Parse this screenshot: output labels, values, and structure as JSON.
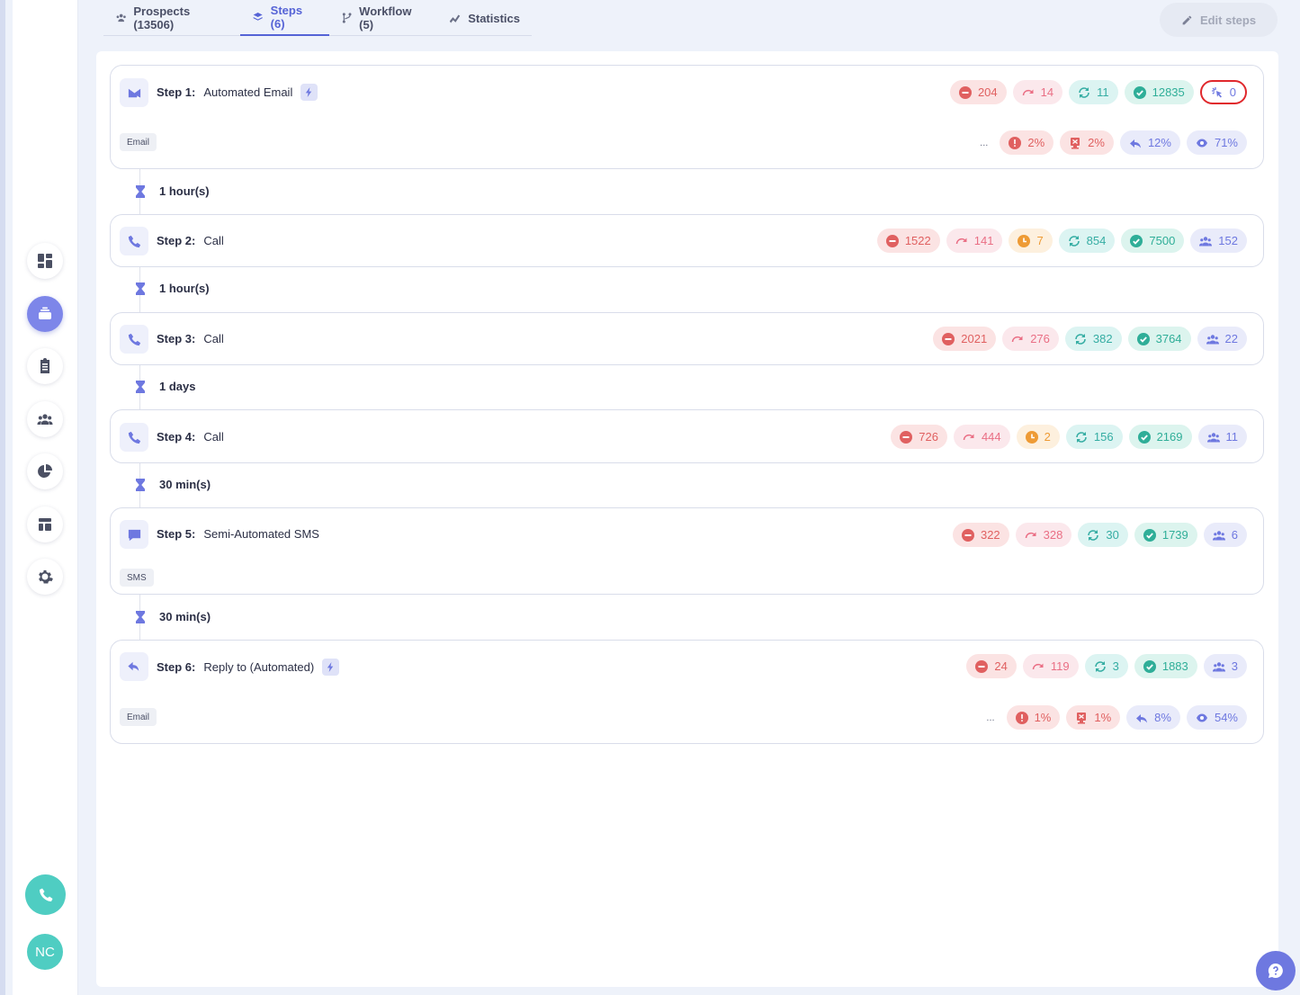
{
  "tabs": [
    {
      "label": "Prospects (13506)",
      "icon": "users-icon",
      "active": false
    },
    {
      "label": "Steps (6)",
      "icon": "layers-icon",
      "active": true
    },
    {
      "label": "Workflow (5)",
      "icon": "flow-icon",
      "active": false
    },
    {
      "label": "Statistics",
      "icon": "chart-line-icon",
      "active": false
    }
  ],
  "edit_button": {
    "label": "Edit steps"
  },
  "sidebar": {
    "items": [
      "dashboard-icon",
      "sequences-icon",
      "tasks-icon",
      "contacts-icon",
      "reports-icon",
      "templates-icon",
      "settings-icon"
    ],
    "active_index": 1,
    "avatar": "NC"
  },
  "steps": [
    {
      "label": "Step 1:",
      "name": "Automated Email",
      "type": "email",
      "automated": true,
      "tag": "Email",
      "stats": [
        "204",
        "14",
        "11",
        "12835",
        "0"
      ],
      "rates": [
        "2%",
        "2%",
        "12%",
        "71%"
      ],
      "ellipsis": "..."
    },
    {
      "label": "Step 2:",
      "name": "Call",
      "type": "call",
      "stats": [
        "1522",
        "141",
        "7",
        "854",
        "7500",
        "152"
      ]
    },
    {
      "label": "Step 3:",
      "name": "Call",
      "type": "call",
      "stats": [
        "2021",
        "276",
        "382",
        "3764",
        "22"
      ]
    },
    {
      "label": "Step 4:",
      "name": "Call",
      "type": "call",
      "stats": [
        "726",
        "444",
        "2",
        "156",
        "2169",
        "11"
      ]
    },
    {
      "label": "Step 5:",
      "name": "Semi-Automated SMS",
      "type": "sms",
      "tag": "SMS",
      "stats": [
        "322",
        "328",
        "30",
        "1739",
        "6"
      ]
    },
    {
      "label": "Step 6:",
      "name": "Reply to (Automated)",
      "type": "reply",
      "automated": true,
      "tag": "Email",
      "stats": [
        "24",
        "119",
        "3",
        "1883",
        "3"
      ],
      "rates": [
        "1%",
        "1%",
        "8%",
        "54%"
      ],
      "ellipsis": "..."
    }
  ],
  "delays": [
    "1 hour(s)",
    "1 hour(s)",
    "1 days",
    "30 min(s)",
    "30 min(s)"
  ],
  "colors": {
    "accent": "#5563d6",
    "red": "#e06060",
    "teal": "#35ada3",
    "orange": "#ee9b35",
    "indigo": "#6e78e0"
  }
}
